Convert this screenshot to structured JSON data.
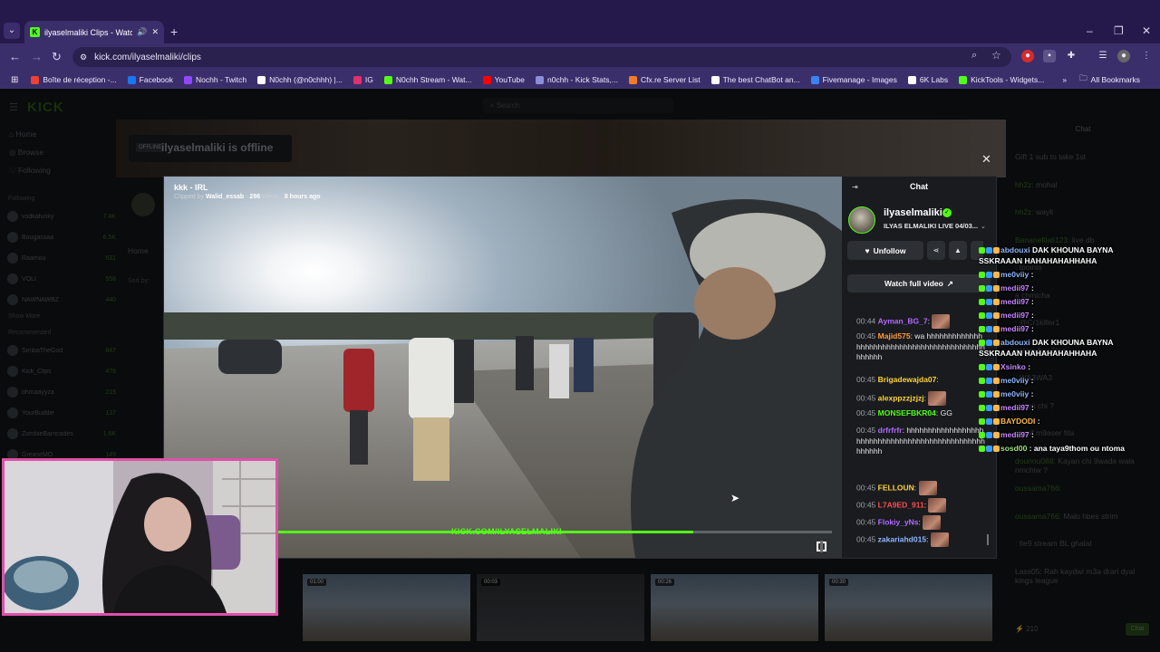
{
  "browser": {
    "tab_title": "ilyaselmaliki Clips - Watch I",
    "url": "kick.com/ilyaselmaliki/clips",
    "bookmarks": [
      {
        "label": "Boîte de réception -...",
        "color": "#ea4335"
      },
      {
        "label": "Facebook",
        "color": "#1877f2"
      },
      {
        "label": "Nochh - Twitch",
        "color": "#9146ff"
      },
      {
        "label": "N0chh (@n0chhh) |...",
        "color": "#ffffff"
      },
      {
        "label": "IG",
        "color": "#e1306c"
      },
      {
        "label": "N0chh Stream - Wat...",
        "color": "#53fc18"
      },
      {
        "label": "YouTube",
        "color": "#ff0000"
      },
      {
        "label": "n0chh - Kick Stats,...",
        "color": "#8a8fd8"
      },
      {
        "label": "Cfx.re Server List",
        "color": "#f27b2a"
      },
      {
        "label": "The best ChatBot an...",
        "color": "#ffffff"
      },
      {
        "label": "Fivemanage - Images",
        "color": "#3b82f6"
      },
      {
        "label": "6K Labs",
        "color": "#ffffff"
      },
      {
        "label": "KickTools - Widgets...",
        "color": "#53fc18"
      }
    ],
    "all_bookmarks": "All Bookmarks"
  },
  "kick": {
    "search_placeholder": "Search",
    "nav": [
      "Home",
      "Browse",
      "Following"
    ],
    "following_label": "Following",
    "following": [
      {
        "name": "vodkafunky",
        "count": "7.4K"
      },
      {
        "name": "Bougassaa",
        "count": "6.5K"
      },
      {
        "name": "Raamou",
        "count": "631"
      },
      {
        "name": "VOLI",
        "count": "558"
      },
      {
        "name": "NAWNAWBZ",
        "count": "440"
      }
    ],
    "show_more": "Show More",
    "recommended_label": "Recommended",
    "recommended": [
      {
        "name": "SimbaTheGod",
        "count": "847"
      },
      {
        "name": "Kick_Clips",
        "count": "476"
      },
      {
        "name": "ohmaayyza",
        "count": "215"
      },
      {
        "name": "YourBuddie",
        "count": "137"
      },
      {
        "name": "ZombieBarricades",
        "count": "1.6K"
      },
      {
        "name": "GreaseMO",
        "count": "149"
      }
    ],
    "offline_badge": "OFFLINE",
    "offline_text": "ilyaselmaliki is offline",
    "home_tab": "Home",
    "sort_by": "Sort by:",
    "chat_title": "Chat",
    "bg_chat": [
      {
        "user": "",
        "text": "Gift 1 sub to take 1st"
      },
      {
        "user": "hh2z:",
        "text": " mohal"
      },
      {
        "user": "hh2z:",
        "text": " wayli"
      },
      {
        "user": "Bananefilali123:",
        "text": " live db"
      },
      {
        "user": "",
        "text": ": tpoints"
      },
      {
        "user": "",
        "text": "a chmicha"
      },
      {
        "user": "",
        "text": ": @Cr1killer1"
      },
      {
        "user": "",
        "text": "salam fara3ina"
      },
      {
        "user": "",
        "text": ": WA3WA3"
      },
      {
        "user": "",
        "text": ": kayn chi ?"
      },
      {
        "user": "",
        "text": "cherif m9aser fita"
      },
      {
        "user": "dounou088:",
        "text": " Kayan chi 9wada wala nmchiw ?"
      },
      {
        "user": "oussama766:",
        "text": ""
      },
      {
        "user": "oussama766:",
        "text": " Malo hbes strim"
      },
      {
        "user": "",
        "text": ": tle9 stream BL ghalat"
      },
      {
        "user": "",
        "text": "Lass05: Rah kaydwi m3a drari dyal kings league"
      }
    ],
    "bg_chat_count": "210",
    "bg_chat_send": "Chat"
  },
  "modal": {
    "clip_title": "kkk - IRL",
    "clipped_by_label": "Clipped by",
    "clipped_by": "Walid_essab",
    "views": "286",
    "views_label": "Views",
    "ago": "8 hours ago",
    "watermark": "KICK.COM/ILYASELMALIKI",
    "progress": 0.75,
    "chat_title": "Chat",
    "channel": "ilyaselmaliki",
    "stream_title": "ILYAS ELMALIKI LIVE 04/03...",
    "unfollow_label": "Unfollow",
    "watch_full_label": "Watch full video",
    "messages": [
      {
        "ts": "00:44",
        "user": "Ayman_BG_7",
        "color": "#b36bff",
        "text": "",
        "emote": true
      },
      {
        "ts": "00:45",
        "user": "Majid575",
        "color": "#ff9a3c",
        "text": " wa hhhhhhhhhhhhhhhhhhhhhhhhhhhhhhhhhhhhhhhhhhhhhhhhh"
      },
      {
        "ts": "00:45",
        "user": "Brigadewajda07",
        "color": "#ffd23c",
        "text": ""
      },
      {
        "ts": "00:45",
        "user": "alexppzzjzjzj",
        "color": "#ffd23c",
        "text": "",
        "emote": true
      },
      {
        "ts": "00:45",
        "user": "MONSEFBKR04",
        "color": "#53fc18",
        "text": " GG"
      },
      {
        "ts": "00:45",
        "user": "drfrfrfr",
        "color": "#b36bff",
        "text": " hhhhhhhhhhhhhhhhhhhhhhhhhhhhhhhhhhhhhhhhhhhhhhhhhhhhhh"
      },
      {
        "ts": "00:45",
        "user": "FELLOUN",
        "color": "#ffd23c",
        "text": "",
        "emote": true
      },
      {
        "ts": "00:45",
        "user": "L7A9ED_911",
        "color": "#ff4d4d",
        "text": "",
        "emote": true
      },
      {
        "ts": "00:45",
        "user": "Flokiy_yNs",
        "color": "#b36bff",
        "text": "",
        "emote": true
      },
      {
        "ts": "00:45",
        "user": "zakariahd015",
        "color": "#8fb6ff",
        "text": "",
        "emote": true
      }
    ]
  },
  "overlay_chat": [
    {
      "user": "abdouxi",
      "cls": "u2",
      "text": " DAK KHOUNA BAYNA"
    },
    {
      "user": "",
      "cls": "",
      "text": "SSKRAAAN HAHAHAHAHHAHA"
    },
    {
      "user": "me0viiy",
      "cls": "u2",
      "text": " :"
    },
    {
      "user": "medii97",
      "cls": "u",
      "text": " :"
    },
    {
      "user": "medii97",
      "cls": "u",
      "text": " :"
    },
    {
      "user": "medii97",
      "cls": "u",
      "text": " :"
    },
    {
      "user": "medii97",
      "cls": "u",
      "text": " :"
    },
    {
      "user": "abdouxi",
      "cls": "u2",
      "text": " DAK KHOUNA BAYNA"
    },
    {
      "user": "",
      "cls": "",
      "text": "SSKRAAAN HAHAHAHAHHAHA"
    },
    {
      "user": "Xsinko",
      "cls": "u",
      "text": " :"
    },
    {
      "user": "me0viiy",
      "cls": "u2",
      "text": " :"
    },
    {
      "user": "me0viiy",
      "cls": "u2",
      "text": " :"
    },
    {
      "user": "medii97",
      "cls": "u",
      "text": " :"
    },
    {
      "user": "BAYDODI",
      "cls": "u3",
      "text": " :"
    },
    {
      "user": "medii97",
      "cls": "u",
      "text": " :"
    },
    {
      "user": "sosd00",
      "cls": "u4",
      "text": " : ana taya9thom ou ntoma"
    }
  ]
}
